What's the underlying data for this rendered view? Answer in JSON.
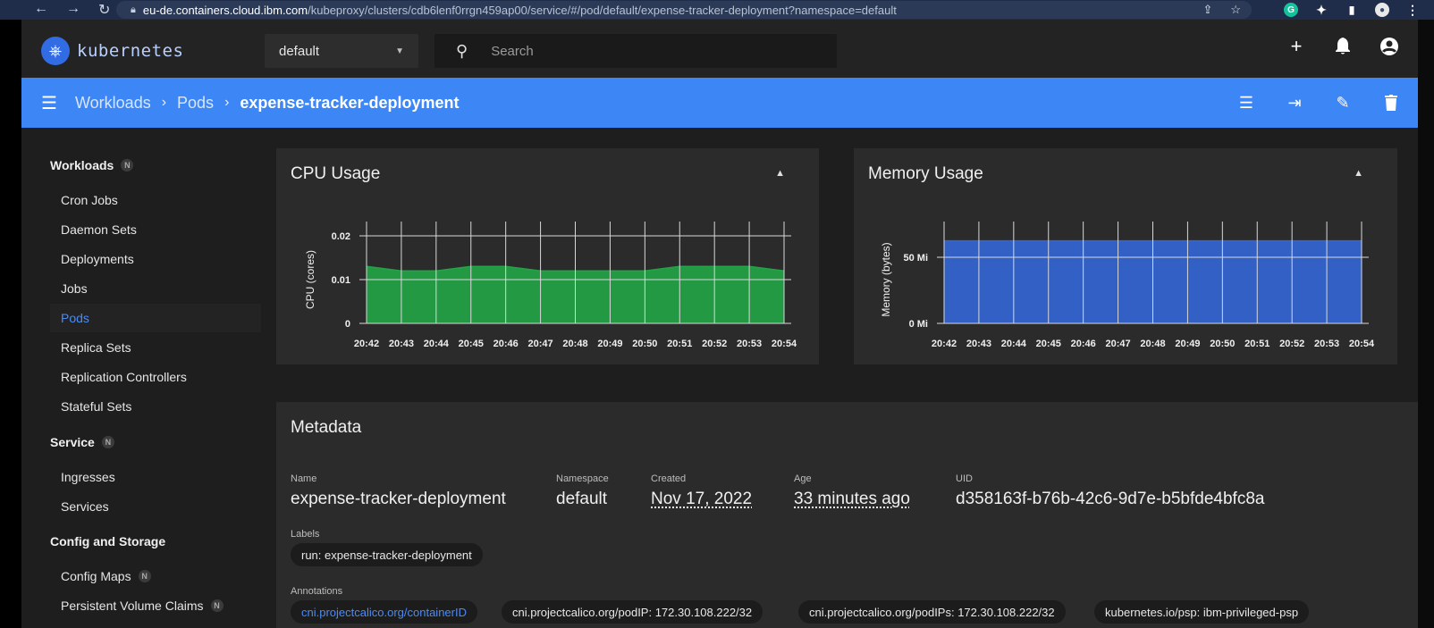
{
  "browser": {
    "url_host": "eu-de.containers.cloud.ibm.com",
    "url_path": "/kubeproxy/clusters/cdb6lenf0rrgn459ap00/service/#/pod/default/expense-tracker-deployment?namespace=default"
  },
  "header": {
    "logo_text": "kubernetes",
    "namespace": "default",
    "search_placeholder": "Search"
  },
  "breadcrumb": {
    "items": [
      "Workloads",
      "Pods"
    ],
    "current": "expense-tracker-deployment"
  },
  "sidebar": {
    "workloads": {
      "title": "Workloads",
      "badge": "N",
      "items": [
        "Cron Jobs",
        "Daemon Sets",
        "Deployments",
        "Jobs",
        "Pods",
        "Replica Sets",
        "Replication Controllers",
        "Stateful Sets"
      ],
      "active": "Pods"
    },
    "service": {
      "title": "Service",
      "badge": "N",
      "items": [
        "Ingresses",
        "Services"
      ]
    },
    "config": {
      "title": "Config and Storage",
      "items": [
        "Config Maps",
        "Persistent Volume Claims"
      ],
      "item_badge": "N"
    }
  },
  "chart_data": [
    {
      "type": "area",
      "title": "CPU Usage",
      "ylabel": "CPU (cores)",
      "yticks": [
        "0",
        "0.01",
        "0.02"
      ],
      "ylim": [
        0,
        0.02
      ],
      "x": [
        "20:42",
        "20:43",
        "20:44",
        "20:45",
        "20:46",
        "20:47",
        "20:48",
        "20:49",
        "20:50",
        "20:51",
        "20:52",
        "20:53",
        "20:54"
      ],
      "values": [
        0.013,
        0.012,
        0.012,
        0.013,
        0.013,
        0.012,
        0.012,
        0.012,
        0.012,
        0.013,
        0.013,
        0.013,
        0.012
      ],
      "color": "#22a547",
      "grid": true
    },
    {
      "type": "area",
      "title": "Memory Usage",
      "ylabel": "Memory (bytes)",
      "yticks": [
        "0 Mi",
        "50 Mi"
      ],
      "ylim": [
        0,
        70
      ],
      "x": [
        "20:42",
        "20:43",
        "20:44",
        "20:45",
        "20:46",
        "20:47",
        "20:48",
        "20:49",
        "20:50",
        "20:51",
        "20:52",
        "20:53",
        "20:54"
      ],
      "values": [
        66,
        66,
        66,
        66,
        66,
        66,
        66,
        66,
        66,
        66,
        66,
        66,
        66
      ],
      "color": "#3366d6",
      "grid": true
    }
  ],
  "metadata": {
    "title": "Metadata",
    "name_label": "Name",
    "name": "expense-tracker-deployment",
    "namespace_label": "Namespace",
    "namespace": "default",
    "created_label": "Created",
    "created": "Nov 17, 2022",
    "age_label": "Age",
    "age": "33 minutes ago",
    "uid_label": "UID",
    "uid": "d358163f-b76b-42c6-9d7e-b5bfde4bfc8a",
    "labels_label": "Labels",
    "labels": [
      "run: expense-tracker-deployment"
    ],
    "annotations_label": "Annotations",
    "annotations": [
      "cni.projectcalico.org/containerID",
      "cni.projectcalico.org/podIP: 172.30.108.222/32",
      "cni.projectcalico.org/podIPs: 172.30.108.222/32",
      "kubernetes.io/psp: ibm-privileged-psp"
    ]
  }
}
